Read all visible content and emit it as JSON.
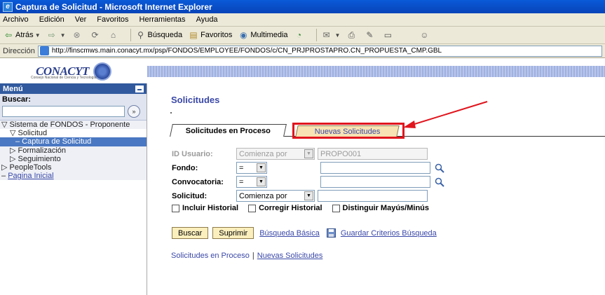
{
  "window": {
    "title": "Captura de Solicitud - Microsoft Internet Explorer"
  },
  "menubar": {
    "items": [
      "Archivo",
      "Edición",
      "Ver",
      "Favoritos",
      "Herramientas",
      "Ayuda"
    ]
  },
  "toolbar": {
    "back_label": "Atrás",
    "search_label": "Búsqueda",
    "favorites_label": "Favoritos",
    "media_label": "Multimedia"
  },
  "addressbar": {
    "label": "Dirección",
    "url": "http://finscmws.main.conacyt.mx/psp/FONDOS/EMPLOYEE/FONDOS/c/CN_PRJPROSTAPRO.CN_PROPUESTA_CMP.GBL"
  },
  "header": {
    "logo_text": "CONACYT",
    "logo_subtitle": "Consejo Nacional de Ciencia y Tecnología"
  },
  "sidebar": {
    "title": "Menú",
    "search_label": "Buscar:",
    "search_value": "",
    "tree": {
      "root": "Sistema de FONDOS - Proponente",
      "solicitud": "Solicitud",
      "captura": "– Captura de Solicitud",
      "formalizacion": "Formalización",
      "seguimiento": "Seguimiento",
      "peopletools": "PeopleTools",
      "pagina_inicial": "Pagina Inicial"
    }
  },
  "main": {
    "page_title": "Solicitudes",
    "tabs": [
      {
        "label": "Solicitudes en Proceso",
        "active": true
      },
      {
        "label": "Nuevas Solicitudes",
        "active": false
      }
    ],
    "form": {
      "id_usuario": {
        "label": "ID Usuario:",
        "operator": "Comienza por",
        "value": "PROPO001"
      },
      "fondo": {
        "label": "Fondo:",
        "operator": "=",
        "value": ""
      },
      "convocatoria": {
        "label": "Convocatoria:",
        "operator": "=",
        "value": ""
      },
      "solicitud": {
        "label": "Solicitud:",
        "operator": "Comienza por",
        "value": ""
      }
    },
    "checkboxes": {
      "incluir_historial": "Incluir Historial",
      "corregir_historial": "Corregir Historial",
      "distinguir": "Distinguir Mayús/Minús"
    },
    "actions": {
      "buscar": "Buscar",
      "suprimir": "Suprimir",
      "busqueda_basica": "Búsqueda Básica",
      "guardar_criterios": "Guardar Criterios Búsqueda"
    },
    "bottom_links": {
      "en_proceso": "Solicitudes en Proceso",
      "nuevas": "Nuevas Solicitudes"
    }
  },
  "colors": {
    "highlight": "#e0151d",
    "link": "#3b49a8",
    "titlebar": "#0a5ad8",
    "menu_header": "#315a9e"
  }
}
